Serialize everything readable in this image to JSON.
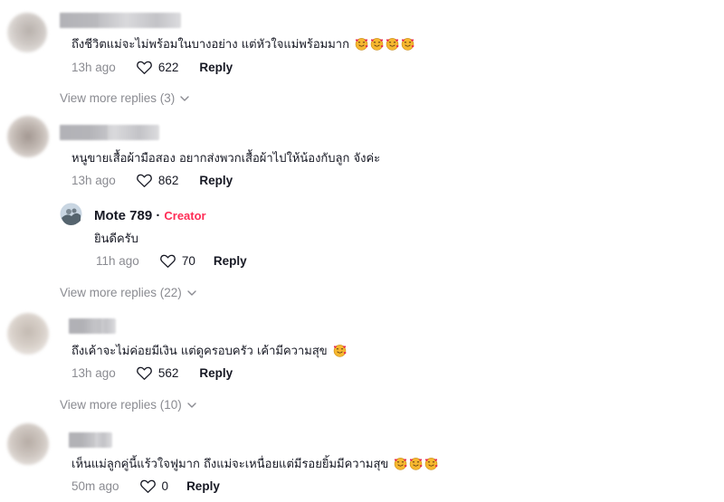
{
  "comments": [
    {
      "text": "ถึงชีวิตแม่จะไม่พร้อมในบางอย่าง แต่หัวใจแม่พร้อมมาก",
      "emoji_count": 4,
      "time": "13h ago",
      "likes": "622",
      "reply_label": "Reply",
      "view_more": "View more replies (3)"
    },
    {
      "text": "หนูขายเสื้อผ้ามือสอง อยากส่งพวกเสื้อผ้าไปให้น้องกับลูก จังค่ะ",
      "emoji_count": 0,
      "time": "13h ago",
      "likes": "862",
      "reply_label": "Reply",
      "creator_reply": {
        "name": "Mote 789",
        "separator": "·",
        "badge": "Creator",
        "text": "ยินดีครับ",
        "time": "11h ago",
        "likes": "70",
        "reply_label": "Reply"
      },
      "view_more": "View more replies (22)"
    },
    {
      "text": "ถึงเค้าจะไม่ค่อยมีเงิน แต่ดูครอบครัว เค้ามีความสุข",
      "emoji_count": 1,
      "time": "13h ago",
      "likes": "562",
      "reply_label": "Reply",
      "view_more": "View more replies (10)"
    },
    {
      "text": "เห็นแม่ลูกคู่นี้แร้วใจฟูมาก ถึงแม่จะเหนื่อยแต่มีรอยยิ้มมีความสุข",
      "emoji_count": 3,
      "time": "50m ago",
      "likes": "0",
      "reply_label": "Reply"
    }
  ],
  "icons": {
    "emoji": "smiling-face-with-hearts-icon",
    "like": "heart-outline-icon",
    "expand": "chevron-down-icon"
  },
  "colors": {
    "text": "#161823",
    "muted": "#8a8b91",
    "creator_badge": "#fe2c55",
    "emoji_face": "#f7b82f"
  }
}
